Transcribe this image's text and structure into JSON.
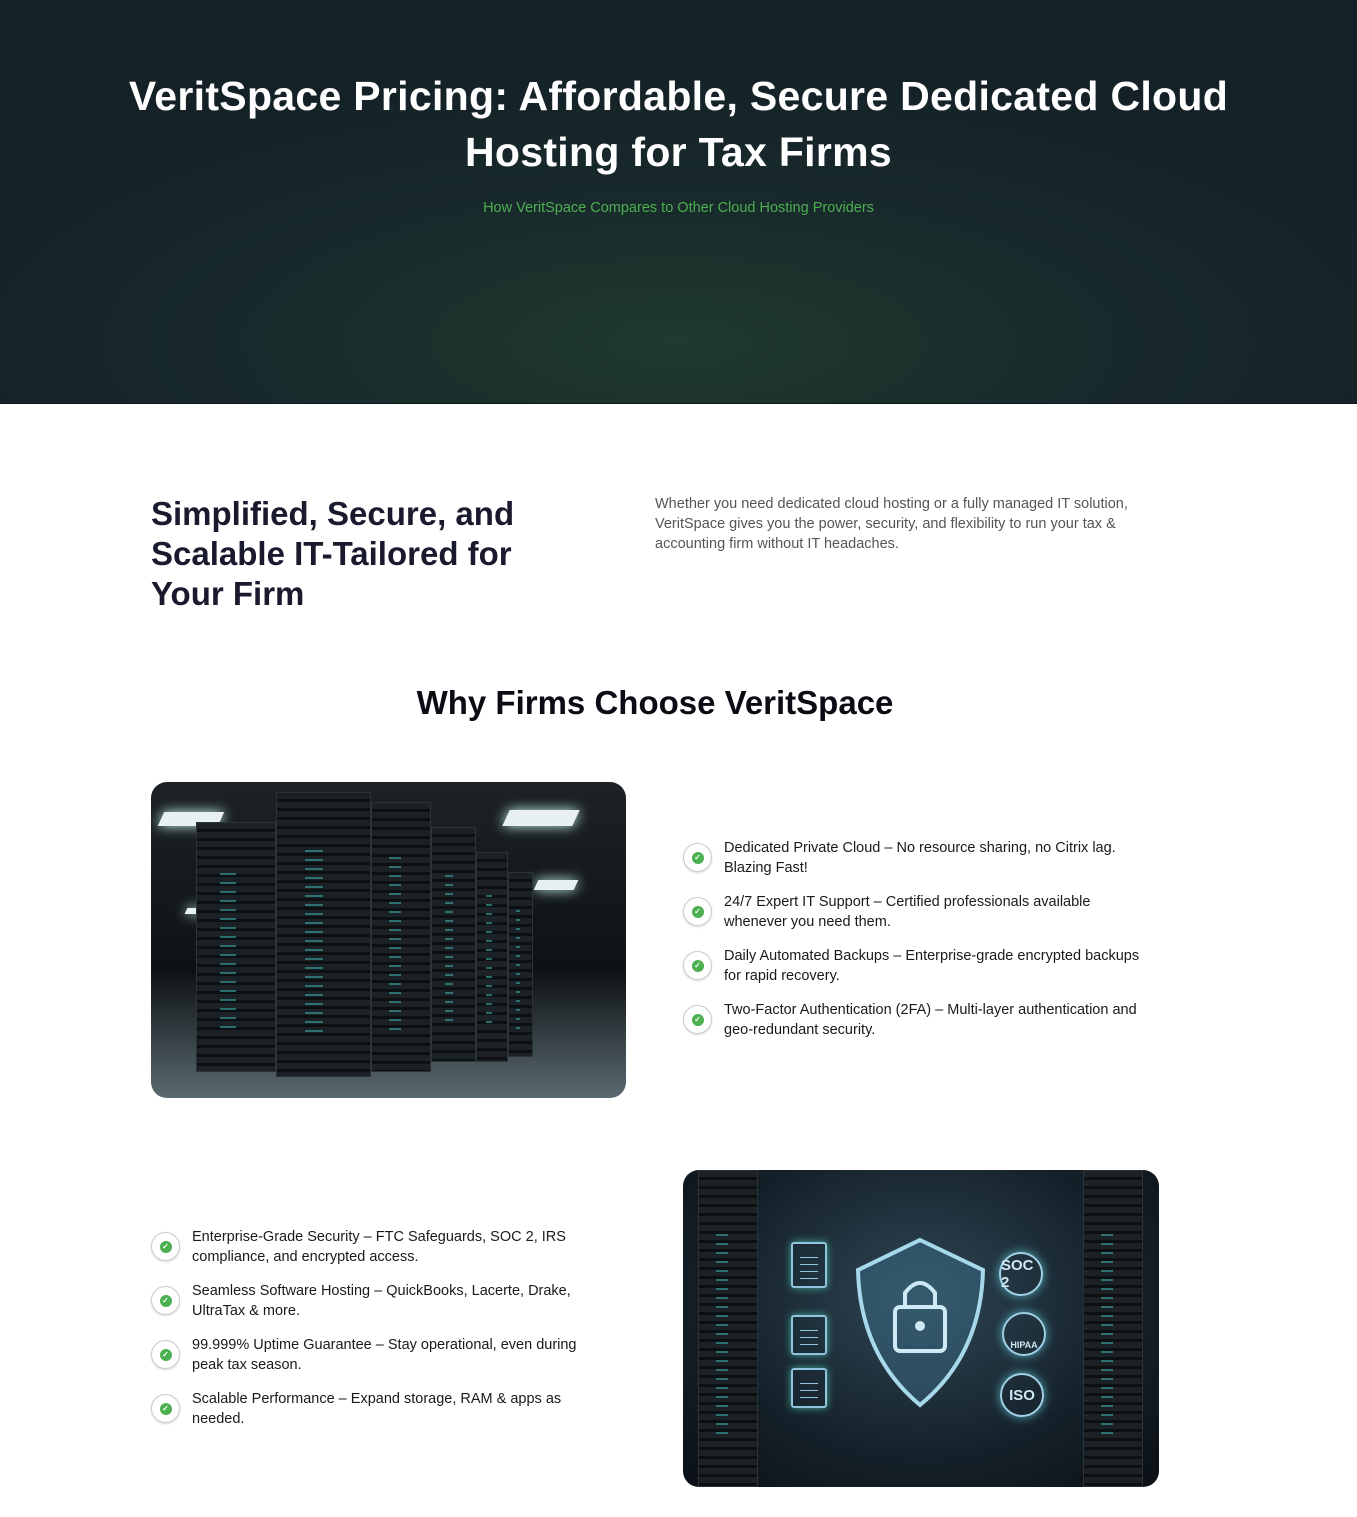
{
  "hero": {
    "title": "VeritSpace Pricing: Affordable, Secure Dedicated Cloud Hosting for Tax Firms",
    "subtitle": "How VeritSpace Compares to Other Cloud Hosting Providers",
    "accent": "#4caf50"
  },
  "intro": {
    "heading": "Simplified, Secure, and Scalable IT-Tailored for Your Firm",
    "text": "Whether you need dedicated cloud hosting or a fully managed IT solution, VeritSpace gives you the power, security, and flexibility to run your tax & accounting firm without IT headaches."
  },
  "why": {
    "heading": "Why Firms Choose VeritSpace"
  },
  "features1": [
    "Dedicated Private Cloud – No resource sharing, no Citrix lag. Blazing Fast!",
    "24/7 Expert IT Support – Certified professionals available whenever you need them.",
    "Daily Automated Backups – Enterprise-grade encrypted backups for rapid recovery.",
    "Two-Factor Authentication (2FA) – Multi-layer authentication and geo-redundant security."
  ],
  "features2": [
    "Enterprise-Grade Security – FTC Safeguards, SOC 2, IRS compliance, and encrypted access.",
    "Seamless Software Hosting – QuickBooks, Lacerte, Drake, UltraTax & more.",
    "99.999% Uptime Guarantee – Stay operational, even during peak tax season.",
    "Scalable Performance – Expand storage, RAM & apps as needed."
  ],
  "badges": {
    "soc": "SOC 2",
    "hipaa": "HIPAA",
    "iso": "ISO"
  },
  "check_icon": "check-circle-icon"
}
